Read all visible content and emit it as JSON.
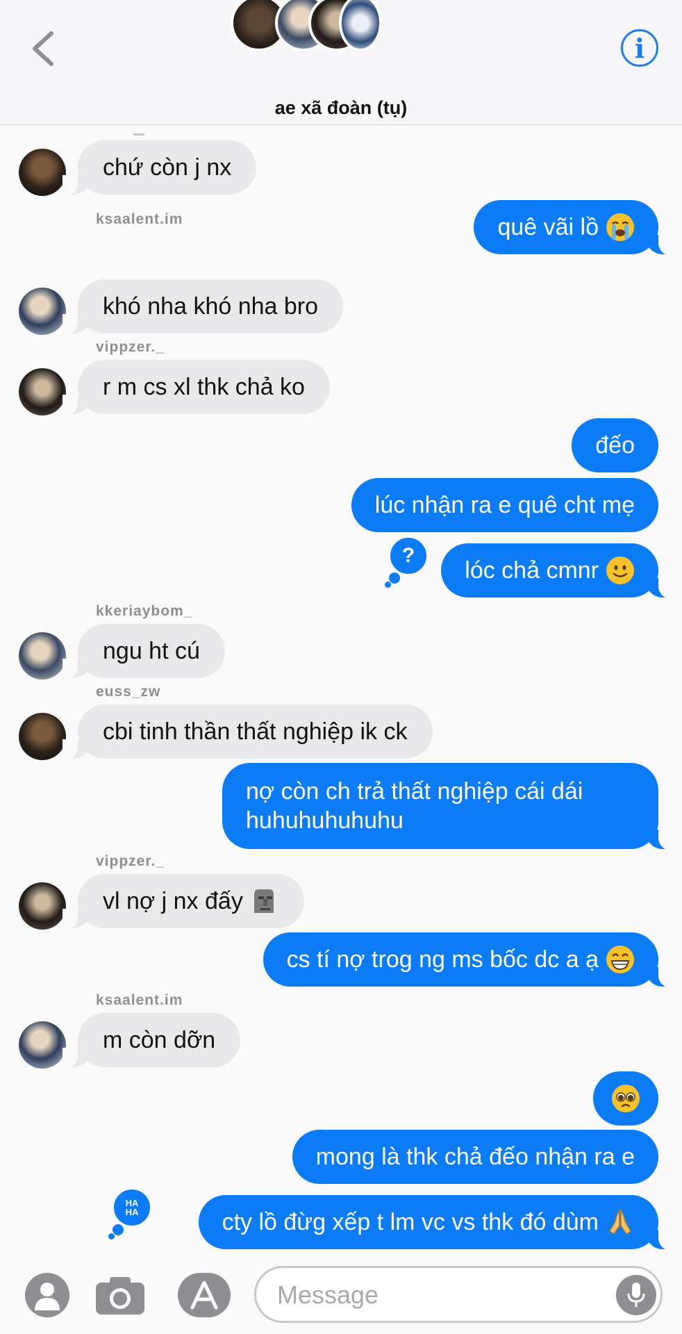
{
  "header": {
    "title": "ae xã đoàn (tụ)",
    "back_icon": "chevron-left-icon",
    "info_icon": "info-icon",
    "info_glyph": "i"
  },
  "colors": {
    "outgoing": "#0b7cf5",
    "incoming": "#e9e9eb",
    "accent": "#1a7cf0"
  },
  "messages": [
    {
      "dir": "in",
      "sender": "",
      "text": "chứ còn j nx"
    },
    {
      "dir": "out",
      "text": "quê vãi lồ",
      "emoji": "loudly-crying-face"
    },
    {
      "dir": "in",
      "sender": "ksaalent.im",
      "text": "khó nha khó nha bro"
    },
    {
      "dir": "in",
      "sender": "vippzer._",
      "text": "r m cs xl thk chả ko"
    },
    {
      "dir": "out",
      "text": "đếo"
    },
    {
      "dir": "out",
      "text": "lúc nhận ra e quê cht mẹ"
    },
    {
      "dir": "out",
      "text": "lóc chả cmnr",
      "emoji": "slightly-smiling-face",
      "tapback": "?"
    },
    {
      "dir": "in",
      "sender": "kkeriaybom_",
      "text": "ngu ht cú"
    },
    {
      "dir": "in",
      "sender": "euss_zw",
      "text": "cbi tinh thần thất nghiệp ik ck"
    },
    {
      "dir": "out",
      "text": "nợ còn ch trả thất nghiệp cái dái huhuhuhuhuhu"
    },
    {
      "dir": "in",
      "sender": "vippzer._",
      "text": "vl nợ j nx đấy",
      "emoji": "moai"
    },
    {
      "dir": "out",
      "text": "cs tí nợ trog ng ms bốc dc a ạ",
      "emoji": "grinning-face"
    },
    {
      "dir": "in",
      "sender": "ksaalent.im",
      "text": "m còn dỡn"
    },
    {
      "dir": "out",
      "text": "",
      "emoji": "pleading-face"
    },
    {
      "dir": "out",
      "text": "mong là thk chả đếo nhận ra e"
    },
    {
      "dir": "out",
      "text": "cty lồ đừg xếp t lm vc vs thk đó dùm",
      "emoji": "folded-hands",
      "tapback": "HA HA"
    }
  ],
  "composer": {
    "placeholder": "Message",
    "contacts_icon": "person-icon",
    "camera_icon": "camera-icon",
    "apps_icon": "app-store-icon",
    "mic_icon": "microphone-icon"
  }
}
